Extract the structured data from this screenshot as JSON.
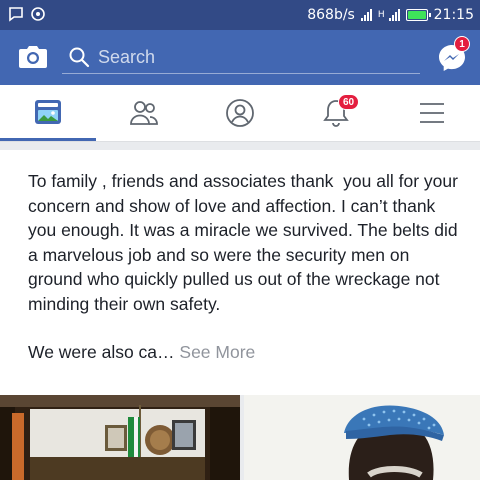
{
  "status_bar": {
    "icons_left": [
      "message-icon",
      "circle-icon"
    ],
    "network_speed": "868b/s",
    "signal_label": "H",
    "battery_level": 1.0,
    "time": "21:15"
  },
  "topbar": {
    "search_placeholder": "Search",
    "messenger_badge": "1",
    "colors": {
      "bar": "#4267b2",
      "badge": "#e41e3f"
    }
  },
  "nav": {
    "tabs": [
      {
        "icon": "news-feed-icon",
        "active": true
      },
      {
        "icon": "friends-icon",
        "active": false
      },
      {
        "icon": "profile-icon",
        "active": false
      },
      {
        "icon": "notifications-bell-icon",
        "badge": "60",
        "active": false
      },
      {
        "icon": "menu-icon",
        "active": false
      }
    ]
  },
  "post": {
    "paragraph_1": "To family , friends and associates thank  you all for your concern and show of love and affection. I can’t thank you enough. It was a miracle we survived. The belts did a marvelous job and so were the security men on ground who quickly pulled us out of the wreckage not minding their own safety.",
    "paragraph_2": "We were also ca… ",
    "see_more": "See More"
  },
  "photos": [
    {
      "description_icon": "office-photo"
    },
    {
      "description_icon": "man-with-cap-photo"
    }
  ]
}
